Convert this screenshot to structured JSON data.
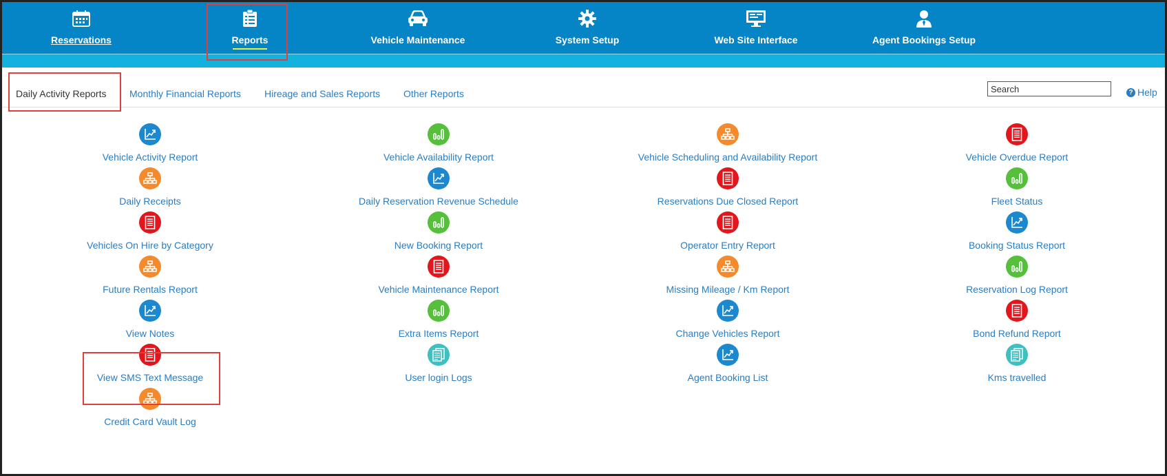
{
  "nav": {
    "items": [
      {
        "label": "Reservations",
        "icon": "calendar-icon"
      },
      {
        "label": "Reports",
        "icon": "checklist-icon"
      },
      {
        "label": "Vehicle Maintenance",
        "icon": "car-icon"
      },
      {
        "label": "System Setup",
        "icon": "gear-icon"
      },
      {
        "label": "Web Site Interface",
        "icon": "monitor-icon"
      },
      {
        "label": "Agent Bookings Setup",
        "icon": "agent-icon"
      }
    ],
    "active": "Reports"
  },
  "tabs": [
    {
      "label": "Daily Activity Reports",
      "active": true
    },
    {
      "label": "Monthly Financial Reports"
    },
    {
      "label": "Hireage and Sales Reports"
    },
    {
      "label": "Other Reports"
    }
  ],
  "search": {
    "placeholder": "Search"
  },
  "help": {
    "label": "Help"
  },
  "colors": {
    "nav_bg": "#0584c6",
    "subbar": "#12b1de",
    "link": "#2b7cc0",
    "icon_blue": "#1b88cf",
    "icon_green": "#56bf3c",
    "icon_orange": "#f48a2c",
    "icon_red": "#e2161d",
    "icon_teal": "#3fbfbf",
    "highlight": "#e0403a"
  },
  "reports": {
    "col1": [
      {
        "label": "Vehicle Activity Report",
        "icon": "line-chart-icon",
        "color": "blue"
      },
      {
        "label": "Daily Receipts",
        "icon": "org-chart-icon",
        "color": "orange"
      },
      {
        "label": "Vehicles On Hire by Category",
        "icon": "document-icon",
        "color": "red"
      },
      {
        "label": "Future Rentals Report",
        "icon": "org-chart-icon",
        "color": "orange"
      },
      {
        "label": "View Notes",
        "icon": "line-chart-icon",
        "color": "blue"
      },
      {
        "label": "View SMS Text Message",
        "icon": "document-icon",
        "color": "red"
      },
      {
        "label": "Credit Card Vault Log",
        "icon": "org-chart-icon",
        "color": "orange"
      }
    ],
    "col2": [
      {
        "label": "Vehicle Availability Report",
        "icon": "bar-chart-icon",
        "color": "green"
      },
      {
        "label": "Daily Reservation Revenue Schedule",
        "icon": "line-chart-icon",
        "color": "blue"
      },
      {
        "label": "New Booking Report",
        "icon": "bar-chart-icon",
        "color": "green"
      },
      {
        "label": "Vehicle Maintenance Report",
        "icon": "document-icon",
        "color": "red"
      },
      {
        "label": "Extra Items Report",
        "icon": "bar-chart-icon",
        "color": "green"
      },
      {
        "label": "User login Logs",
        "icon": "log-list-icon",
        "color": "teal"
      }
    ],
    "col3": [
      {
        "label": "Vehicle Scheduling and Availability Report",
        "icon": "org-chart-icon",
        "color": "orange"
      },
      {
        "label": "Reservations Due Closed Report",
        "icon": "document-icon",
        "color": "red"
      },
      {
        "label": "Operator Entry Report",
        "icon": "document-icon",
        "color": "red"
      },
      {
        "label": "Missing Mileage / Km Report",
        "icon": "org-chart-icon",
        "color": "orange"
      },
      {
        "label": "Change Vehicles Report",
        "icon": "line-chart-icon",
        "color": "blue"
      },
      {
        "label": "Agent Booking List",
        "icon": "line-chart-icon",
        "color": "blue"
      }
    ],
    "col4": [
      {
        "label": "Vehicle Overdue Report",
        "icon": "document-icon",
        "color": "red"
      },
      {
        "label": "Fleet Status",
        "icon": "bar-chart-icon",
        "color": "green"
      },
      {
        "label": "Booking Status Report",
        "icon": "line-chart-icon",
        "color": "blue"
      },
      {
        "label": "Reservation Log Report",
        "icon": "bar-chart-icon",
        "color": "green"
      },
      {
        "label": "Bond Refund Report",
        "icon": "document-icon",
        "color": "red"
      },
      {
        "label": "Kms travelled",
        "icon": "log-list-icon",
        "color": "teal"
      }
    ]
  }
}
